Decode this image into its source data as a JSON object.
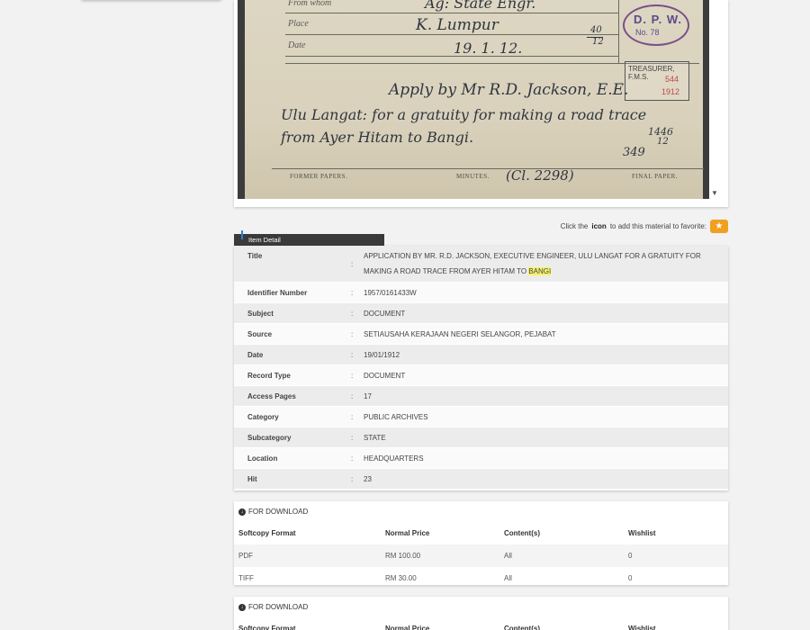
{
  "document_image": {
    "from_label": "From whom",
    "place_label": "Place",
    "date_label": "Date",
    "from_value": "Ag: State Engr.",
    "place_value": "K. Lumpur",
    "date_value": "19. 1. 12.",
    "fraction_top": "40",
    "fraction_bottom": "12",
    "stamp_dpw": "D. P. W.",
    "stamp_dpw_no": "No. 78",
    "stamp_treasury": "TREASURER, F.M.S.",
    "stamp_treasury_num": "544",
    "stamp_treasury_year": "1912",
    "handwriting_line1": "Apply by Mr R.D. Jackson, E.E.",
    "handwriting_line2": "Ulu Langat: for a gratuity for making a road trace",
    "handwriting_line3": "from Ayer Hitam to Bangi.",
    "margin_ref1": "1446",
    "margin_ref2": "12",
    "margin_ref3": "349",
    "former_papers": "FORMER PAPERS.",
    "minutes": "MINUTES.",
    "minutes_ref": "(Cl. 2298)",
    "final_paper": "FINAL PAPER."
  },
  "favorite": {
    "prefix": "Click the",
    "icon_word": "icon",
    "suffix": "to add this material to favorite:",
    "star": "★"
  },
  "item_detail": {
    "tab_label": "Item Detail",
    "rows": [
      {
        "key": "Title",
        "value_part1": "APPLICATION BY MR. R.D. JACKSON, EXECUTIVE ENGINEER, ULU LANGAT FOR A GRATUITY FOR MAKING A ROAD TRACE FROM AYER HITAM TO ",
        "value_highlight": "BANGI"
      },
      {
        "key": "Identifier Number",
        "value": "1957/0161433W"
      },
      {
        "key": "Subject",
        "value": "DOCUMENT"
      },
      {
        "key": "Source",
        "value": "SETIAUSAHA KERAJAAN NEGERI SELANGOR, PEJABAT"
      },
      {
        "key": "Date",
        "value": "19/01/1912"
      },
      {
        "key": "Record Type",
        "value": "DOCUMENT"
      },
      {
        "key": "Access Pages",
        "value": "17"
      },
      {
        "key": "Category",
        "value": "PUBLIC ARCHIVES"
      },
      {
        "key": "Subcategory",
        "value": "STATE"
      },
      {
        "key": "Location",
        "value": "HEADQUARTERS"
      },
      {
        "key": "Hit",
        "value": "23"
      }
    ],
    "colon": ":"
  },
  "downloads": [
    {
      "heading": "FOR DOWNLOAD",
      "columns": [
        "Softcopy Format",
        "Normal Price",
        "Content(s)",
        "Wishlist"
      ],
      "rows": [
        [
          "PDF",
          "RM 100.00",
          "All",
          "0"
        ],
        [
          "TIFF",
          "RM 30.00",
          "All",
          "0"
        ]
      ]
    },
    {
      "heading": "FOR DOWNLOAD",
      "columns": [
        "Softcopy Format",
        "Normal Price",
        "Content(s)",
        "Wishlist"
      ]
    }
  ]
}
